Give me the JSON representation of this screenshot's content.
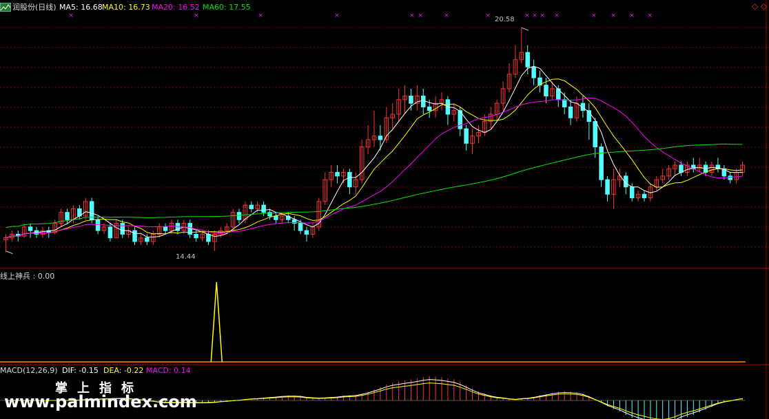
{
  "header": {
    "title": "润股份(日线)",
    "ma5": "MA5: 16.68",
    "ma10": "MA10: 16.73",
    "ma20": "MA20: 16.52",
    "ma60": "MA60: 17.55"
  },
  "indicator": {
    "label": "线上神兵 : 0.00"
  },
  "macd": {
    "name": "MACD(12,26,9)",
    "dif": "DIF: -0.15",
    "dea": "DEA: -0.22",
    "macd": "MACD: 0.14"
  },
  "annotations": {
    "high": "20.58",
    "low": "14.44"
  },
  "watermark": {
    "cn": "掌上指标",
    "url": "www.palmindex.com"
  },
  "colors": {
    "up": "#ff3232",
    "down": "#54fcfc",
    "ma5": "#ffffff",
    "ma10": "#ffff00",
    "ma20": "#ff00ff",
    "ma60": "#00e600",
    "grid": "#800000",
    "axis": "#b00000"
  },
  "chart_data": {
    "type": "candlestick",
    "price_range": [
      14.0,
      21.0
    ],
    "high_point": 20.58,
    "low_point": 14.44,
    "candles": [
      [
        14.75,
        14.8,
        14.4,
        14.9
      ],
      [
        14.8,
        14.9,
        14.7,
        15.0
      ],
      [
        14.9,
        14.85,
        14.7,
        15.0
      ],
      [
        14.85,
        15.1,
        14.8,
        15.2
      ],
      [
        15.1,
        15.0,
        14.8,
        15.2
      ],
      [
        15.0,
        14.9,
        14.8,
        15.1
      ],
      [
        14.9,
        15.0,
        14.8,
        15.1
      ],
      [
        15.0,
        14.95,
        14.8,
        15.1
      ],
      [
        14.95,
        15.2,
        14.9,
        15.3
      ],
      [
        15.2,
        15.5,
        15.1,
        15.6
      ],
      [
        15.5,
        15.3,
        15.2,
        15.6
      ],
      [
        15.3,
        15.6,
        15.2,
        15.7
      ],
      [
        15.6,
        15.4,
        15.3,
        15.7
      ],
      [
        15.4,
        15.8,
        15.3,
        15.9
      ],
      [
        15.8,
        15.3,
        15.2,
        15.9
      ],
      [
        15.3,
        15.0,
        14.9,
        15.4
      ],
      [
        15.0,
        15.1,
        14.9,
        15.2
      ],
      [
        15.1,
        14.8,
        14.7,
        15.2
      ],
      [
        14.8,
        15.2,
        14.8,
        15.3
      ],
      [
        15.2,
        14.9,
        14.8,
        15.3
      ],
      [
        14.9,
        15.0,
        14.8,
        15.1
      ],
      [
        15.0,
        14.7,
        14.6,
        15.1
      ],
      [
        14.7,
        14.8,
        14.6,
        14.9
      ],
      [
        14.8,
        14.7,
        14.6,
        14.9
      ],
      [
        14.7,
        14.9,
        14.6,
        15.0
      ],
      [
        14.9,
        15.1,
        14.8,
        15.2
      ],
      [
        15.1,
        15.0,
        14.9,
        15.2
      ],
      [
        15.0,
        15.2,
        14.9,
        15.3
      ],
      [
        15.2,
        15.0,
        14.9,
        15.3
      ],
      [
        15.0,
        15.2,
        14.9,
        15.3
      ],
      [
        15.2,
        14.9,
        14.8,
        15.3
      ],
      [
        14.9,
        14.8,
        14.7,
        15.0
      ],
      [
        14.8,
        14.9,
        14.7,
        15.0
      ],
      [
        14.9,
        14.7,
        14.6,
        15.0
      ],
      [
        14.7,
        14.9,
        14.44,
        15.0
      ],
      [
        14.9,
        15.0,
        14.8,
        15.1
      ],
      [
        15.0,
        15.1,
        14.9,
        15.2
      ],
      [
        15.1,
        15.5,
        15.0,
        15.6
      ],
      [
        15.5,
        15.3,
        15.2,
        15.6
      ],
      [
        15.3,
        15.7,
        15.2,
        15.8
      ],
      [
        15.7,
        15.6,
        15.5,
        15.8
      ],
      [
        15.6,
        15.7,
        15.5,
        15.8
      ],
      [
        15.7,
        15.5,
        15.4,
        15.8
      ],
      [
        15.5,
        15.4,
        15.3,
        15.6
      ],
      [
        15.4,
        15.3,
        15.2,
        15.5
      ],
      [
        15.3,
        15.4,
        15.2,
        15.5
      ],
      [
        15.4,
        15.3,
        15.2,
        15.5
      ],
      [
        15.3,
        15.2,
        15.0,
        15.4
      ],
      [
        15.2,
        15.0,
        14.9,
        15.3
      ],
      [
        15.0,
        14.9,
        14.7,
        15.1
      ],
      [
        14.9,
        15.1,
        14.8,
        15.2
      ],
      [
        15.1,
        15.8,
        15.0,
        15.9
      ],
      [
        15.8,
        16.4,
        15.7,
        16.6
      ],
      [
        16.4,
        16.6,
        16.2,
        16.8
      ],
      [
        16.6,
        16.5,
        16.3,
        16.8
      ],
      [
        16.5,
        16.6,
        16.3,
        16.7
      ],
      [
        16.6,
        16.2,
        16.0,
        16.7
      ],
      [
        16.2,
        16.4,
        16.0,
        16.6
      ],
      [
        16.4,
        17.3,
        16.3,
        17.5
      ],
      [
        17.3,
        17.5,
        17.1,
        17.9
      ],
      [
        17.5,
        17.6,
        17.3,
        18.3
      ],
      [
        17.6,
        17.5,
        17.2,
        17.9
      ],
      [
        17.5,
        18.1,
        17.4,
        18.4
      ],
      [
        18.1,
        18.2,
        17.8,
        18.5
      ],
      [
        18.2,
        18.6,
        18.0,
        18.9
      ],
      [
        18.6,
        18.7,
        18.2,
        19.0
      ],
      [
        18.7,
        18.5,
        18.3,
        18.9
      ],
      [
        18.5,
        18.7,
        18.3,
        19.0
      ],
      [
        18.7,
        18.4,
        18.2,
        18.9
      ],
      [
        18.4,
        18.3,
        18.1,
        18.6
      ],
      [
        18.3,
        18.5,
        18.1,
        18.7
      ],
      [
        18.5,
        18.6,
        18.3,
        18.8
      ],
      [
        18.6,
        18.2,
        17.9,
        18.7
      ],
      [
        18.2,
        18.3,
        18.0,
        18.5
      ],
      [
        18.3,
        17.8,
        17.6,
        18.4
      ],
      [
        17.8,
        17.4,
        17.2,
        17.9
      ],
      [
        17.4,
        17.6,
        17.1,
        17.8
      ],
      [
        17.6,
        17.7,
        17.4,
        17.9
      ],
      [
        17.7,
        18.0,
        17.6,
        18.2
      ],
      [
        18.0,
        18.2,
        17.8,
        18.4
      ],
      [
        18.2,
        18.5,
        18.0,
        18.6
      ],
      [
        18.5,
        18.9,
        18.3,
        19.1
      ],
      [
        18.9,
        19.3,
        18.8,
        19.6
      ],
      [
        19.3,
        19.7,
        19.2,
        20.1
      ],
      [
        19.7,
        19.9,
        19.6,
        20.58
      ],
      [
        19.9,
        19.5,
        19.3,
        20.1
      ],
      [
        19.5,
        19.2,
        19.0,
        19.7
      ],
      [
        19.2,
        19.0,
        18.8,
        19.4
      ],
      [
        19.0,
        18.7,
        18.5,
        19.2
      ],
      [
        18.7,
        18.9,
        18.6,
        19.1
      ],
      [
        18.9,
        18.6,
        18.4,
        19.0
      ],
      [
        18.6,
        18.4,
        18.2,
        18.8
      ],
      [
        18.4,
        18.1,
        17.9,
        18.6
      ],
      [
        18.1,
        18.5,
        18.0,
        18.7
      ],
      [
        18.5,
        18.3,
        18.1,
        18.7
      ],
      [
        18.3,
        18.0,
        17.5,
        18.5
      ],
      [
        18.0,
        17.3,
        17.0,
        18.1
      ],
      [
        17.3,
        16.4,
        16.2,
        17.4
      ],
      [
        16.4,
        16.0,
        15.8,
        16.5
      ],
      [
        16.0,
        16.4,
        15.6,
        16.7
      ],
      [
        16.4,
        16.5,
        16.2,
        16.7
      ],
      [
        16.5,
        16.2,
        16.0,
        16.6
      ],
      [
        16.2,
        15.9,
        15.8,
        16.3
      ],
      [
        15.9,
        16.0,
        15.8,
        16.1
      ],
      [
        16.0,
        15.9,
        15.8,
        16.1
      ],
      [
        15.9,
        16.2,
        15.8,
        16.3
      ],
      [
        16.2,
        16.4,
        16.1,
        16.5
      ],
      [
        16.4,
        16.5,
        16.3,
        16.7
      ],
      [
        16.5,
        16.7,
        16.4,
        16.8
      ],
      [
        16.7,
        16.8,
        16.5,
        16.9
      ],
      [
        16.8,
        16.6,
        16.5,
        16.9
      ],
      [
        16.6,
        16.8,
        16.5,
        16.9
      ],
      [
        16.8,
        16.7,
        16.6,
        17.0
      ],
      [
        16.7,
        16.8,
        16.6,
        17.0
      ],
      [
        16.8,
        16.6,
        16.5,
        16.9
      ],
      [
        16.6,
        16.8,
        16.5,
        16.9
      ],
      [
        16.8,
        16.7,
        16.6,
        17.0
      ],
      [
        16.7,
        16.5,
        16.4,
        16.8
      ],
      [
        16.5,
        16.4,
        16.3,
        16.6
      ],
      [
        16.4,
        16.6,
        16.3,
        16.7
      ],
      [
        16.6,
        16.8,
        16.5,
        16.9
      ]
    ],
    "indicator_signal": {
      "index": 68,
      "value": 1
    }
  }
}
